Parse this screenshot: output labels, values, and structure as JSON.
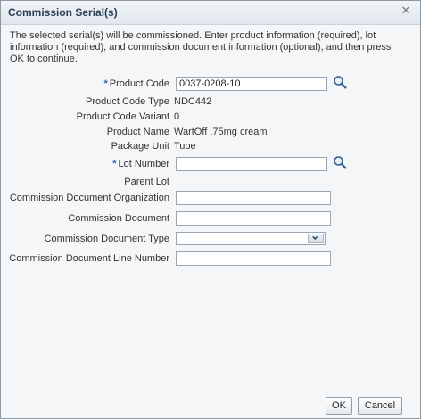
{
  "dialog": {
    "title": "Commission Serial(s)",
    "close_icon": "close-icon",
    "intro": "The selected serial(s) will be commissioned. Enter product information (required), lot information (required), and commission document information (optional), and then press OK to continue."
  },
  "form": {
    "required_marker": "*",
    "product_code": {
      "label": "Product Code",
      "value": "0037-0208-10"
    },
    "product_code_type": {
      "label": "Product Code Type",
      "value": "NDC442"
    },
    "product_code_variant": {
      "label": "Product Code Variant",
      "value": "0"
    },
    "product_name": {
      "label": "Product Name",
      "value": "WartOff .75mg cream"
    },
    "package_unit": {
      "label": "Package Unit",
      "value": "Tube"
    },
    "lot_number": {
      "label": "Lot Number",
      "value": ""
    },
    "parent_lot": {
      "label": "Parent Lot",
      "value": ""
    },
    "commission_document_organization": {
      "label": "Commission Document Organization",
      "value": ""
    },
    "commission_document": {
      "label": "Commission Document",
      "value": ""
    },
    "commission_document_type": {
      "label": "Commission Document Type",
      "value": ""
    },
    "commission_document_line_number": {
      "label": "Commission Document Line Number",
      "value": ""
    }
  },
  "buttons": {
    "ok": "OK",
    "cancel": "Cancel"
  },
  "colors": {
    "required": "#3a67b2",
    "title": "#2b3f57",
    "dialog_bg": "#f4f6f8"
  }
}
